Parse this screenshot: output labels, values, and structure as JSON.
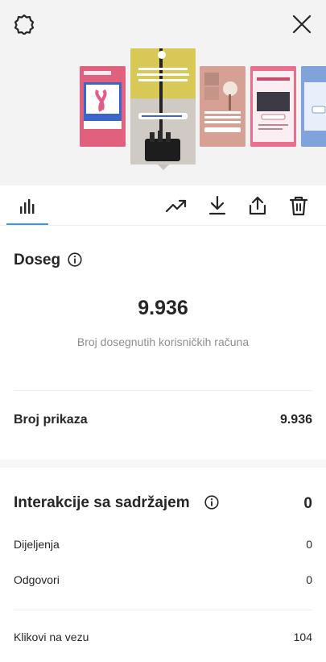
{
  "header": {
    "settings_icon": "settings-icon",
    "close_icon": "close-icon"
  },
  "preview": {
    "thumbnails": [
      {
        "name": "story-thumb-1",
        "color": "#e0607e",
        "caption": ""
      },
      {
        "name": "story-thumb-2",
        "color": "#c7c4bd",
        "caption": "Preporuka računa 2 u 1 usisavača koji nije značajno olakšao svakodnevno čišćenje",
        "link": "ZIBABUSREDZINOKU.COM"
      },
      {
        "name": "story-thumb-3",
        "color": "#d9a59b",
        "caption": "",
        "link": "ZIBABUSREDZINOKU.COM"
      },
      {
        "name": "story-thumb-4",
        "color": "#e96f8d",
        "caption": ""
      },
      {
        "name": "story-thumb-5",
        "color": "#7fa2dc",
        "caption": ""
      }
    ]
  },
  "tabs": {
    "active_color": "#3897f0",
    "icons": [
      "insights-icon",
      "trend-icon",
      "download-icon",
      "share-icon",
      "delete-icon"
    ]
  },
  "reach": {
    "title": "Doseg",
    "value": "9.936",
    "subtitle": "Broj dosegnutih korisničkih računa"
  },
  "impressions": {
    "label": "Broj prikaza",
    "value": "9.936"
  },
  "interactions": {
    "title": "Interakcije sa sadržajem",
    "value": "0",
    "rows": [
      {
        "label": "Dijeljenja",
        "value": "0"
      },
      {
        "label": "Odgovori",
        "value": "0"
      },
      {
        "label": "Klikovi na vezu",
        "value": "104"
      }
    ]
  }
}
